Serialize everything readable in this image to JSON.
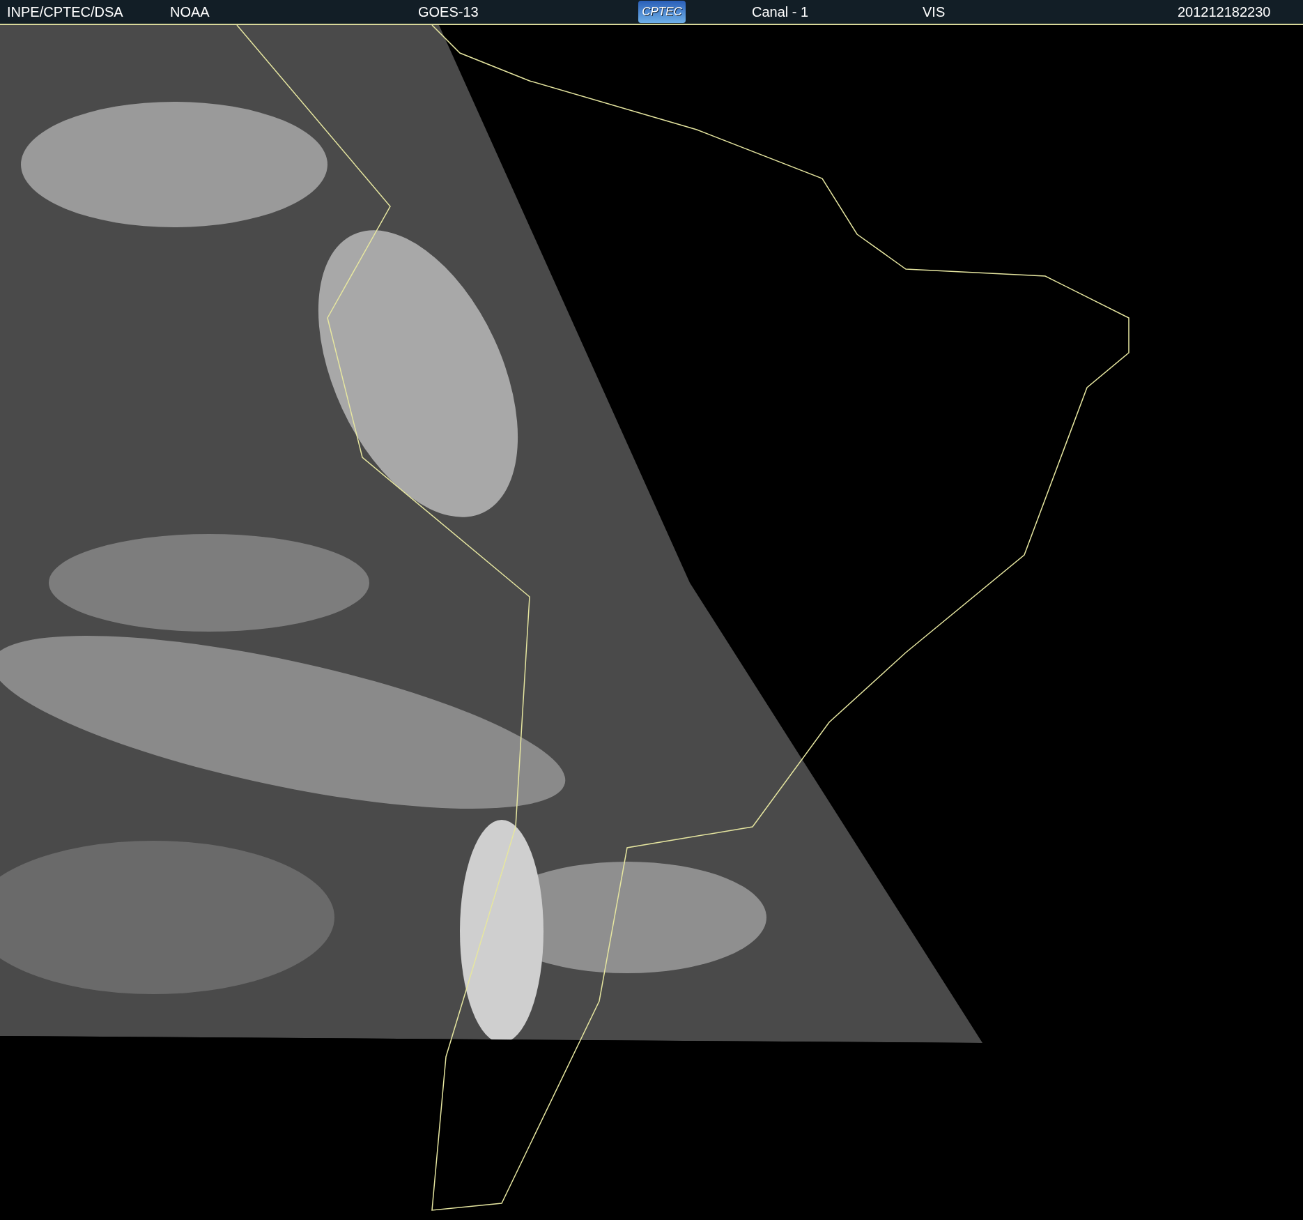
{
  "header": {
    "items": [
      {
        "kind": "text",
        "text": "INPE/CPTEC/DSA"
      },
      {
        "kind": "text",
        "text": "NOAA"
      },
      {
        "kind": "text",
        "text": "GOES-13"
      },
      {
        "kind": "logo",
        "text": "CPTEC"
      },
      {
        "kind": "text",
        "text": "Canal - 1"
      },
      {
        "kind": "text",
        "text": "VIS"
      },
      {
        "kind": "text",
        "text": "201212182230"
      }
    ]
  }
}
